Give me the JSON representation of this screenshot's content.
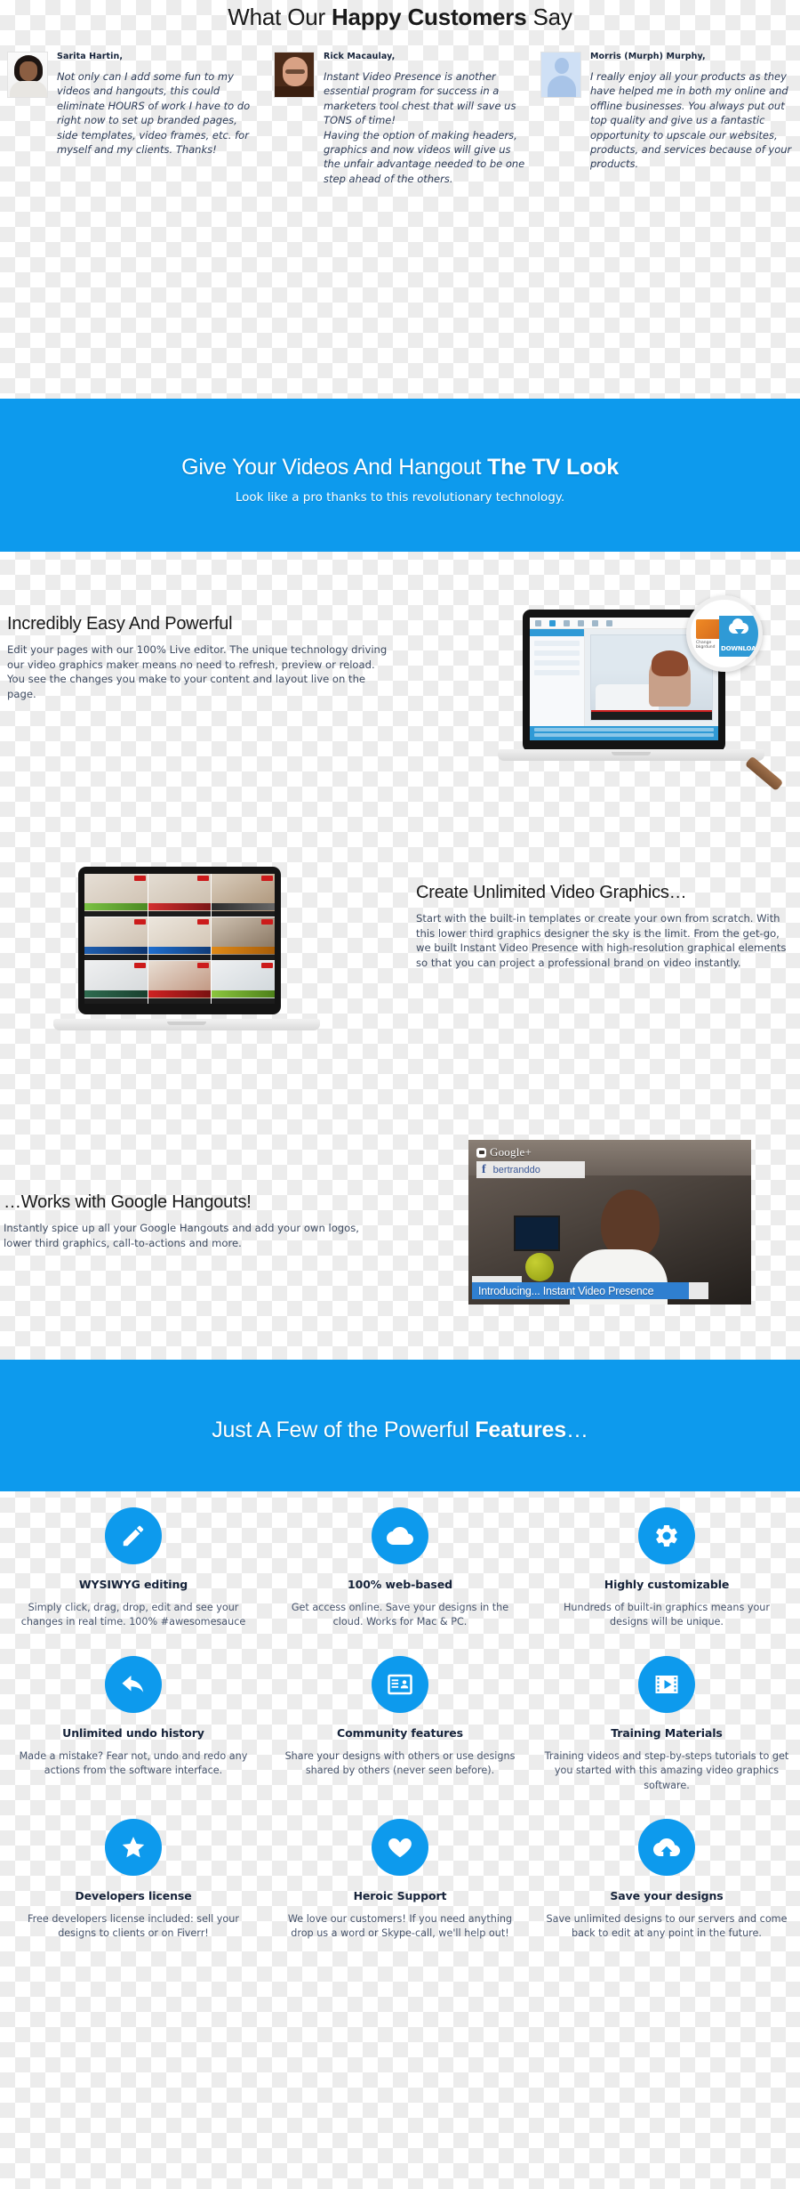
{
  "testimonials_section": {
    "heading_prefix": "What Our ",
    "heading_bold": "Happy Customers",
    "heading_suffix": " Say",
    "items": [
      {
        "name": "Sarita Hartin,",
        "quote": "Not only can I add some fun to my videos and hangouts, this could eliminate HOURS of work I have to do right now to set up branded pages, side templates, video frames, etc. for myself and my clients. Thanks!",
        "avatar": "woman-avatar"
      },
      {
        "name": "Rick Macaulay,",
        "quote_1": "Instant Video Presence is another essential program for success in a marketers tool chest that will save us TONS of time!",
        "quote_2": "Having the option of making headers, graphics and now videos will give us the unfair advantage needed to be one step ahead of the others.",
        "avatar": "man-avatar"
      },
      {
        "name": "Morris (Murph) Murphy,",
        "quote": "I really enjoy all your products as they have helped me in both my online and offline businesses. You always put out top quality and give us a fantastic opportunity to upscale our websites, products, and services because of your products.",
        "avatar": "placeholder-avatar"
      }
    ]
  },
  "band_tv_look": {
    "title_prefix": "Give Your Videos And Hangout ",
    "title_bold": "The TV Look",
    "subtitle": "Look like a pro thanks to this revolutionary technology."
  },
  "section_easy": {
    "heading": "Incredibly Easy And Powerful",
    "body": "Edit your pages with our 100% Live editor. The unique technology driving our video graphics maker means no need to refresh, preview or reload. You see the changes you make to your content and layout live on the page."
  },
  "editor_screenshot": {
    "magnifier_label": "DOWNLOAD",
    "thumb_caption": "Change\nbkgrdund"
  },
  "section_create": {
    "heading": "Create Unlimited Video Graphics…",
    "body": "Start with the built-in templates or create your own from scratch. With this lower third graphics designer the sky is the limit. From the get-go, we built Instant Video Presence with high-resolution graphical elements so that you can project a professional brand on video instantly."
  },
  "section_hangouts": {
    "heading": "…Works with Google Hangouts!",
    "body": "Instantly spice up all your Google Hangouts and add your own logos, lower third graphics, call-to-actions and more."
  },
  "hangout_screenshot": {
    "brand": "Google+",
    "facebook_handle": "bertranddo",
    "facebook_letter": "f",
    "lower_third": "Introducing... Instant Video Presence"
  },
  "band_features": {
    "title_prefix": "Just A Few of the Powerful ",
    "title_bold": "Features",
    "title_suffix": "…"
  },
  "features": [
    {
      "icon": "pencil-icon",
      "title": "WYSIWYG editing",
      "desc": "Simply click, drag, drop, edit and see your changes in real time. 100% #awesomesauce"
    },
    {
      "icon": "cloud-icon",
      "title": "100% web-based",
      "desc": "Get access online. Save your designs in the cloud. Works for Mac & PC."
    },
    {
      "icon": "gear-icon",
      "title": "Highly customizable",
      "desc": "Hundreds of built-in graphics means your designs will be unique."
    },
    {
      "icon": "undo-arrow-icon",
      "title": "Unlimited undo history",
      "desc": "Made a mistake? Fear not, undo and redo any actions from the software interface."
    },
    {
      "icon": "id-card-icon",
      "title": "Community features",
      "desc": "Share your designs with others or use designs shared by others (never seen before)."
    },
    {
      "icon": "film-play-icon",
      "title": "Training Materials",
      "desc": "Training videos and step-by-steps tutorials to get you started with this amazing video graphics software."
    },
    {
      "icon": "star-icon",
      "title": "Developers license",
      "desc": "Free developers license included: sell your designs to clients or on Fiverr!"
    },
    {
      "icon": "heart-icon",
      "title": "Heroic Support",
      "desc": "We love our customers! If you need anything drop us a word or Skype-call, we'll help out!"
    },
    {
      "icon": "cloud-upload-icon",
      "title": "Save your designs",
      "desc": "Save unlimited designs to our servers and come back to edit at any point in the future."
    }
  ],
  "colors": {
    "accent_blue": "#0d9aed",
    "band_blue": "#0d9aed",
    "heading_dark": "#1a1a1a",
    "body_text": "#3d4a60",
    "checker_gray": "#ececec"
  }
}
